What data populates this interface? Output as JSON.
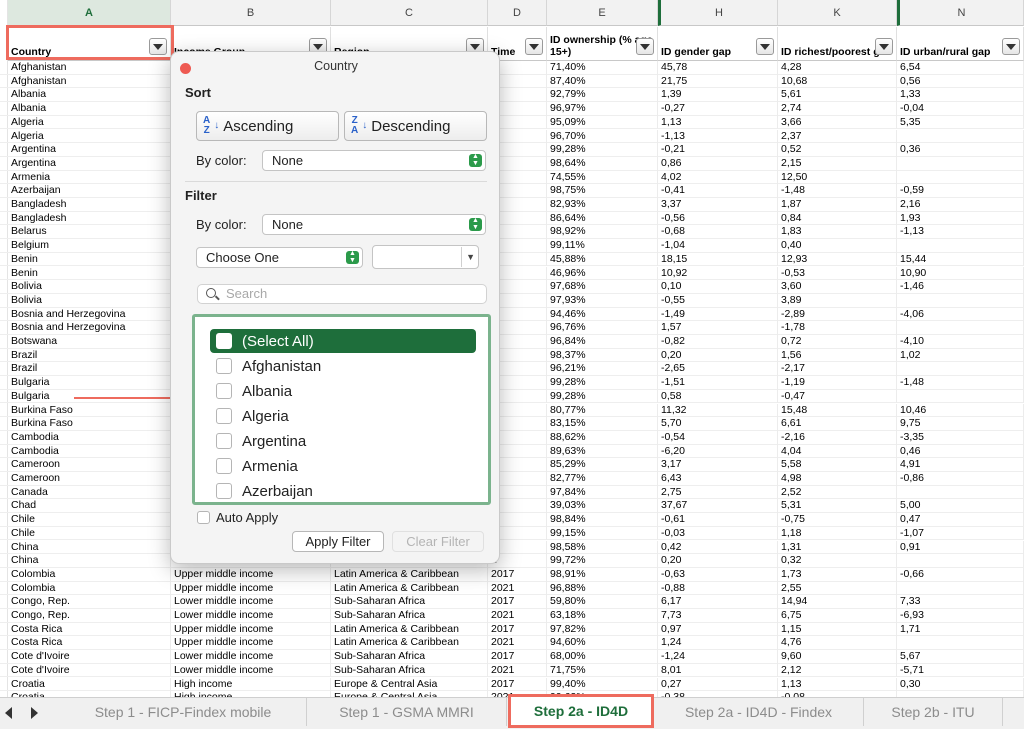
{
  "sheet": {
    "column_headers": [
      {
        "letter": "A"
      },
      {
        "letter": "B"
      },
      {
        "letter": "C"
      },
      {
        "letter": "D"
      },
      {
        "letter": "E"
      },
      {
        "letter": "H"
      },
      {
        "letter": "K"
      },
      {
        "letter": "N"
      }
    ],
    "header_row": [
      "Country",
      "Income Group",
      "Region",
      "Time",
      "ID ownership (% age 15+)",
      "ID gender gap",
      "ID richest/poorest g",
      "ID urban/rural gap"
    ],
    "rows": [
      [
        "Afghanistan",
        "",
        "",
        "7",
        "71,40%",
        "45,78",
        "4,28",
        "6,54"
      ],
      [
        "Afghanistan",
        "",
        "",
        "1",
        "87,40%",
        "21,75",
        "10,68",
        "0,56"
      ],
      [
        "Albania",
        "",
        "",
        "7",
        "92,79%",
        "1,39",
        "5,61",
        "1,33"
      ],
      [
        "Albania",
        "",
        "",
        "1",
        "96,97%",
        "-0,27",
        "2,74",
        "-0,04"
      ],
      [
        "Algeria",
        "",
        "",
        "7",
        "95,09%",
        "1,13",
        "3,66",
        "5,35"
      ],
      [
        "Algeria",
        "",
        "",
        "1",
        "96,70%",
        "-1,13",
        "2,37",
        ""
      ],
      [
        "Argentina",
        "",
        "",
        "7",
        "99,28%",
        "-0,21",
        "0,52",
        "0,36"
      ],
      [
        "Argentina",
        "",
        "",
        "1",
        "98,64%",
        "0,86",
        "2,15",
        ""
      ],
      [
        "Armenia",
        "",
        "",
        "1",
        "74,55%",
        "4,02",
        "12,50",
        ""
      ],
      [
        "Azerbaijan",
        "",
        "",
        "1",
        "98,75%",
        "-0,41",
        "-1,48",
        "-0,59"
      ],
      [
        "Bangladesh",
        "",
        "",
        "7",
        "82,93%",
        "3,37",
        "1,87",
        "2,16"
      ],
      [
        "Bangladesh",
        "",
        "",
        "1",
        "86,64%",
        "-0,56",
        "0,84",
        "1,93"
      ],
      [
        "Belarus",
        "",
        "",
        "1",
        "98,92%",
        "-0,68",
        "1,83",
        "-1,13"
      ],
      [
        "Belgium",
        "",
        "",
        "1",
        "99,11%",
        "-1,04",
        "0,40",
        ""
      ],
      [
        "Benin",
        "",
        "",
        "7",
        "45,88%",
        "18,15",
        "12,93",
        "15,44"
      ],
      [
        "Benin",
        "",
        "",
        "1",
        "46,96%",
        "10,92",
        "-0,53",
        "10,90"
      ],
      [
        "Bolivia",
        "",
        "",
        "7",
        "97,68%",
        "0,10",
        "3,60",
        "-1,46"
      ],
      [
        "Bolivia",
        "",
        "",
        "1",
        "97,93%",
        "-0,55",
        "3,89",
        ""
      ],
      [
        "Bosnia and Herzegovina",
        "",
        "",
        "7",
        "94,46%",
        "-1,49",
        "-2,89",
        "-4,06"
      ],
      [
        "Bosnia and Herzegovina",
        "",
        "",
        "1",
        "96,76%",
        "1,57",
        "-1,78",
        ""
      ],
      [
        "Botswana",
        "",
        "",
        "1",
        "96,84%",
        "-0,82",
        "0,72",
        "-4,10"
      ],
      [
        "Brazil",
        "",
        "",
        "7",
        "98,37%",
        "0,20",
        "1,56",
        "1,02"
      ],
      [
        "Brazil",
        "",
        "",
        "1",
        "96,21%",
        "-2,65",
        "-2,17",
        ""
      ],
      [
        "Bulgaria",
        "",
        "",
        "7",
        "99,28%",
        "-1,51",
        "-1,19",
        "-1,48"
      ],
      [
        "Bulgaria",
        "",
        "",
        "1",
        "99,28%",
        "0,58",
        "-0,47",
        ""
      ],
      [
        "Burkina Faso",
        "",
        "",
        "7",
        "80,77%",
        "11,32",
        "15,48",
        "10,46"
      ],
      [
        "Burkina Faso",
        "",
        "",
        "1",
        "83,15%",
        "5,70",
        "6,61",
        "9,75"
      ],
      [
        "Cambodia",
        "",
        "",
        "7",
        "88,62%",
        "-0,54",
        "-2,16",
        "-3,35"
      ],
      [
        "Cambodia",
        "",
        "",
        "1",
        "89,63%",
        "-6,20",
        "4,04",
        "0,46"
      ],
      [
        "Cameroon",
        "",
        "",
        "7",
        "85,29%",
        "3,17",
        "5,58",
        "4,91"
      ],
      [
        "Cameroon",
        "",
        "",
        "1",
        "82,77%",
        "6,43",
        "4,98",
        "-0,86"
      ],
      [
        "Canada",
        "",
        "",
        "1",
        "97,84%",
        "2,75",
        "2,52",
        ""
      ],
      [
        "Chad",
        "",
        "",
        "7",
        "39,03%",
        "37,67",
        "5,31",
        "5,00"
      ],
      [
        "Chile",
        "",
        "",
        "7",
        "98,84%",
        "-0,61",
        "-0,75",
        "0,47"
      ],
      [
        "Chile",
        "",
        "",
        "1",
        "99,15%",
        "-0,03",
        "1,18",
        "-1,07"
      ],
      [
        "China",
        "",
        "",
        "7",
        "98,58%",
        "0,42",
        "1,31",
        "0,91"
      ],
      [
        "China",
        "",
        "",
        "1",
        "99,72%",
        "0,20",
        "0,32",
        ""
      ],
      [
        "Colombia",
        "Upper middle income",
        "Latin America & Caribbean",
        "2017",
        "98,91%",
        "-0,63",
        "1,73",
        "-0,66"
      ],
      [
        "Colombia",
        "Upper middle income",
        "Latin America & Caribbean",
        "2021",
        "96,88%",
        "-0,88",
        "2,55",
        ""
      ],
      [
        "Congo, Rep.",
        "Lower middle income",
        "Sub-Saharan Africa",
        "2017",
        "59,80%",
        "6,17",
        "14,94",
        "7,33"
      ],
      [
        "Congo, Rep.",
        "Lower middle income",
        "Sub-Saharan Africa",
        "2021",
        "63,18%",
        "7,73",
        "6,75",
        "-6,93"
      ],
      [
        "Costa Rica",
        "Upper middle income",
        "Latin America & Caribbean",
        "2017",
        "97,82%",
        "0,97",
        "1,15",
        "1,71"
      ],
      [
        "Costa Rica",
        "Upper middle income",
        "Latin America & Caribbean",
        "2021",
        "94,60%",
        "1,24",
        "4,76",
        ""
      ],
      [
        "Cote d'Ivoire",
        "Lower middle income",
        "Sub-Saharan Africa",
        "2017",
        "68,00%",
        "-1,24",
        "9,60",
        "5,67"
      ],
      [
        "Cote d'Ivoire",
        "Lower middle income",
        "Sub-Saharan Africa",
        "2021",
        "71,75%",
        "8,01",
        "2,12",
        "-5,71"
      ],
      [
        "Croatia",
        "High income",
        "Europe & Central Asia",
        "2017",
        "99,40%",
        "0,27",
        "1,13",
        "0,30"
      ],
      [
        "Croatia",
        "High income",
        "Europe & Central Asia",
        "2021",
        "99,62%",
        "-0,38",
        "-0,08",
        ""
      ]
    ]
  },
  "popup": {
    "title": "Country",
    "sort_heading": "Sort",
    "ascending_label": "Ascending",
    "descending_label": "Descending",
    "sort_asc_icon_top": "A",
    "sort_asc_icon_bottom": "Z",
    "sort_desc_icon_top": "Z",
    "sort_desc_icon_bottom": "A",
    "sort_by_color_label": "By color:",
    "sort_by_color_value": "None",
    "filter_heading": "Filter",
    "filter_by_color_label": "By color:",
    "filter_by_color_value": "None",
    "choose_one_value": "Choose One",
    "condition_value": "",
    "search_placeholder": "Search",
    "list_items": [
      {
        "label": "(Select All)",
        "checked": false
      },
      {
        "label": "Afghanistan",
        "checked": false
      },
      {
        "label": "Albania",
        "checked": false
      },
      {
        "label": "Algeria",
        "checked": false
      },
      {
        "label": "Argentina",
        "checked": false
      },
      {
        "label": "Armenia",
        "checked": false
      },
      {
        "label": "Azerbaijan",
        "checked": false
      }
    ],
    "auto_apply_label": "Auto Apply",
    "apply_label": "Apply Filter",
    "clear_label": "Clear Filter"
  },
  "tabs": [
    {
      "label": "Step 1 - FICP-Findex mobile",
      "active": false
    },
    {
      "label": "Step 1 - GSMA MMRI",
      "active": false
    },
    {
      "label": "Step 2a - ID4D",
      "active": true
    },
    {
      "label": "Step 2a - ID4D - Findex",
      "active": false
    },
    {
      "label": "Step 2b - ITU",
      "active": false
    }
  ],
  "colors": {
    "accent_green": "#1e6e3b",
    "annotation_red": "#ee6b5e",
    "list_border_green": "#7bb38d"
  }
}
